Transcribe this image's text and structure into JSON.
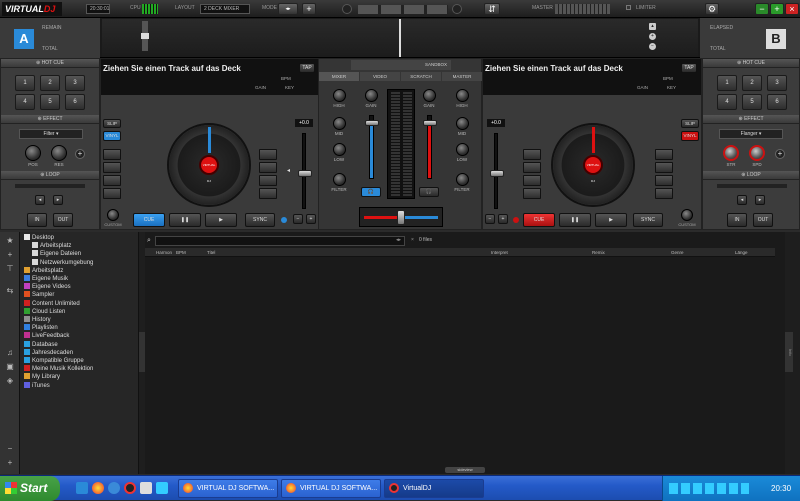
{
  "app": {
    "logo_a": "VIRTUAL",
    "logo_b": "DJ"
  },
  "topbar": {
    "clock": "20:30:01",
    "cpu_label": "CPU",
    "layout_label": "LAYOUT",
    "layout_value": "2 DECK MIXER",
    "mode_label": "MODE",
    "master_label": "MASTER",
    "limiter_label": "LIMITER"
  },
  "deck_a": {
    "letter": "A",
    "remain_label": "REMAIN",
    "total_label": "TOTAL",
    "drop_text": "Ziehen Sie einen Track auf das Deck",
    "tap": "TAP",
    "bpm_label": "BPM",
    "gain_label": "GAIN",
    "key_label": "KEY",
    "pitch_value": "+0.0",
    "slip": "SLIP",
    "vinyl": "VINYL",
    "cue": "CUE",
    "sync": "SYNC",
    "custom": "CUSTOM",
    "center_label": "VIRTUAL DJ"
  },
  "deck_b": {
    "letter": "B",
    "elapsed_label": "ELAPSED",
    "total_label": "TOTAL",
    "drop_text": "Ziehen Sie einen Track auf das Deck",
    "tap": "TAP",
    "bpm_label": "BPM",
    "gain_label": "GAIN",
    "key_label": "KEY",
    "pitch_value": "+0.0",
    "slip": "SLIP",
    "vinyl": "VINYL",
    "cue": "CUE",
    "sync": "SYNC",
    "custom": "CUSTOM",
    "center_label": "VIRTUAL DJ"
  },
  "left_panel": {
    "hotcue_title": "HOT CUE",
    "hotcues": [
      "1",
      "2",
      "3",
      "4",
      "5",
      "6"
    ],
    "effect_title": "EFFECT",
    "effect_value": "Filter",
    "pos_label": "POS",
    "res_label": "RES",
    "loop_title": "LOOP",
    "in_label": "IN",
    "out_label": "OUT"
  },
  "right_panel": {
    "hotcue_title": "HOT CUE",
    "hotcues": [
      "1",
      "2",
      "3",
      "4",
      "5",
      "6"
    ],
    "effect_title": "EFFECT",
    "effect_value": "Flanger",
    "str_label": "STR",
    "spd_label": "SPD",
    "loop_title": "LOOP",
    "in_label": "IN",
    "out_label": "OUT"
  },
  "mixer": {
    "sandbox": "SANDBOX",
    "tabs": [
      "MIXER",
      "VIDEO",
      "SCRATCH",
      "MASTER"
    ],
    "gain": "GAIN",
    "high": "HIGH",
    "mid": "MID",
    "low": "LOW",
    "filter": "FILTER"
  },
  "browser": {
    "file_count": "0 files",
    "columns": [
      "Harmon",
      "BPM",
      "Titel",
      "Interpret",
      "Remix",
      "Genre",
      "Länge"
    ],
    "tree": [
      {
        "label": "Desktop",
        "level": 0,
        "color": "#e8e8e8"
      },
      {
        "label": "Arbeitsplatz",
        "level": 1,
        "color": "#d9d9d9"
      },
      {
        "label": "Eigene Dateien",
        "level": 1,
        "color": "#d9d9d9"
      },
      {
        "label": "Netzwerkumgebung",
        "level": 1,
        "color": "#d9d9d9"
      },
      {
        "label": "Arbeitsplatz",
        "level": 0,
        "color": "#e0a030"
      },
      {
        "label": "Eigene Musik",
        "level": 0,
        "color": "#3a7de0"
      },
      {
        "label": "Eigene Videos",
        "level": 0,
        "color": "#c040c0"
      },
      {
        "label": "Sampler",
        "level": 0,
        "color": "#e05020"
      },
      {
        "label": "Content Unlimited",
        "level": 0,
        "color": "#d02020"
      },
      {
        "label": "Cloud Listen",
        "level": 0,
        "color": "#30a030"
      },
      {
        "label": "History",
        "level": 0,
        "color": "#909090"
      },
      {
        "label": "Playlisten",
        "level": 0,
        "color": "#3080e0"
      },
      {
        "label": "LiveFeedback",
        "level": 0,
        "color": "#c03090"
      },
      {
        "label": "Database",
        "level": 0,
        "color": "#2aa0e0"
      },
      {
        "label": "Jahresdecaden",
        "level": 0,
        "color": "#2aa0e0"
      },
      {
        "label": "Kompatible Gruppe",
        "level": 0,
        "color": "#2aa0e0"
      },
      {
        "label": "Meine Musik Kollektion",
        "level": 0,
        "color": "#d02020"
      },
      {
        "label": "My Library",
        "level": 0,
        "color": "#e0a030"
      },
      {
        "label": "iTunes",
        "level": 0,
        "color": "#6060e0"
      }
    ],
    "sideview": "sideview",
    "info": "Info"
  },
  "taskbar": {
    "start": "Start",
    "tasks": [
      "VIRTUAL DJ SOFTWA...",
      "VIRTUAL DJ SOFTWA...",
      "VirtualDJ"
    ],
    "time": "20:30"
  }
}
